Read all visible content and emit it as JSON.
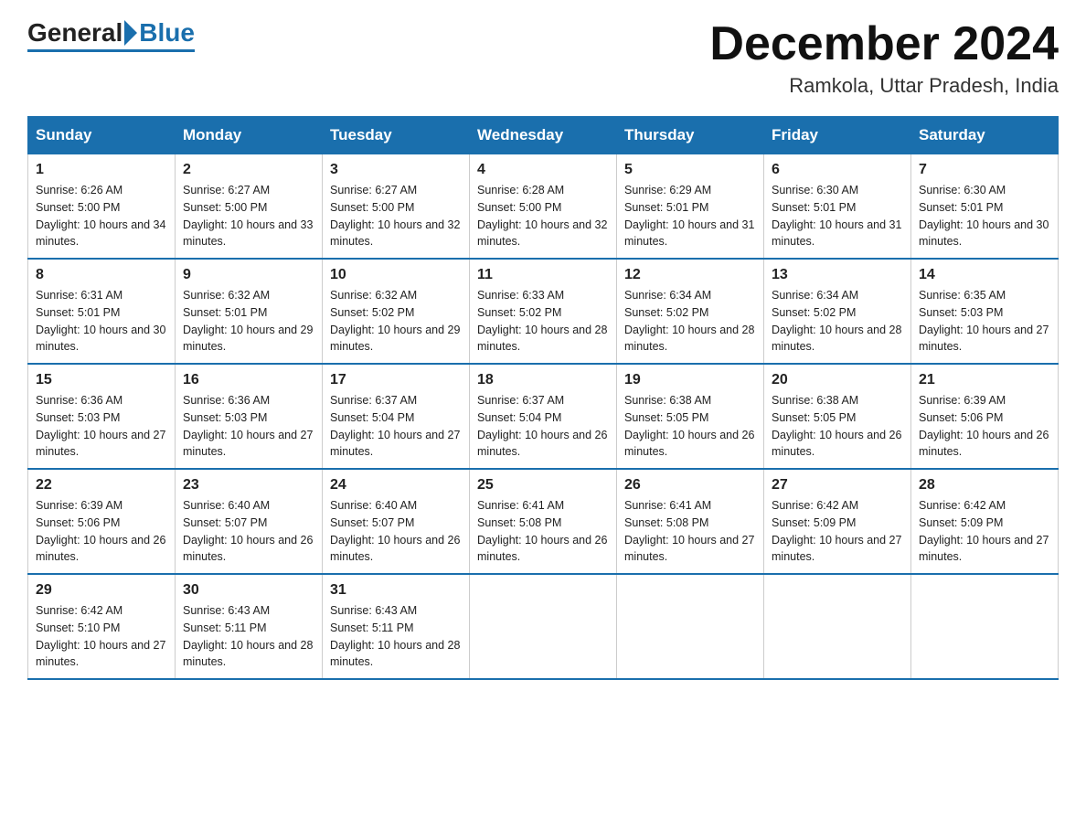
{
  "logo": {
    "general": "General",
    "blue": "Blue"
  },
  "header": {
    "month_title": "December 2024",
    "location": "Ramkola, Uttar Pradesh, India"
  },
  "weekdays": [
    "Sunday",
    "Monday",
    "Tuesday",
    "Wednesday",
    "Thursday",
    "Friday",
    "Saturday"
  ],
  "weeks": [
    [
      {
        "day": "1",
        "sunrise": "6:26 AM",
        "sunset": "5:00 PM",
        "daylight": "10 hours and 34 minutes."
      },
      {
        "day": "2",
        "sunrise": "6:27 AM",
        "sunset": "5:00 PM",
        "daylight": "10 hours and 33 minutes."
      },
      {
        "day": "3",
        "sunrise": "6:27 AM",
        "sunset": "5:00 PM",
        "daylight": "10 hours and 32 minutes."
      },
      {
        "day": "4",
        "sunrise": "6:28 AM",
        "sunset": "5:00 PM",
        "daylight": "10 hours and 32 minutes."
      },
      {
        "day": "5",
        "sunrise": "6:29 AM",
        "sunset": "5:01 PM",
        "daylight": "10 hours and 31 minutes."
      },
      {
        "day": "6",
        "sunrise": "6:30 AM",
        "sunset": "5:01 PM",
        "daylight": "10 hours and 31 minutes."
      },
      {
        "day": "7",
        "sunrise": "6:30 AM",
        "sunset": "5:01 PM",
        "daylight": "10 hours and 30 minutes."
      }
    ],
    [
      {
        "day": "8",
        "sunrise": "6:31 AM",
        "sunset": "5:01 PM",
        "daylight": "10 hours and 30 minutes."
      },
      {
        "day": "9",
        "sunrise": "6:32 AM",
        "sunset": "5:01 PM",
        "daylight": "10 hours and 29 minutes."
      },
      {
        "day": "10",
        "sunrise": "6:32 AM",
        "sunset": "5:02 PM",
        "daylight": "10 hours and 29 minutes."
      },
      {
        "day": "11",
        "sunrise": "6:33 AM",
        "sunset": "5:02 PM",
        "daylight": "10 hours and 28 minutes."
      },
      {
        "day": "12",
        "sunrise": "6:34 AM",
        "sunset": "5:02 PM",
        "daylight": "10 hours and 28 minutes."
      },
      {
        "day": "13",
        "sunrise": "6:34 AM",
        "sunset": "5:02 PM",
        "daylight": "10 hours and 28 minutes."
      },
      {
        "day": "14",
        "sunrise": "6:35 AM",
        "sunset": "5:03 PM",
        "daylight": "10 hours and 27 minutes."
      }
    ],
    [
      {
        "day": "15",
        "sunrise": "6:36 AM",
        "sunset": "5:03 PM",
        "daylight": "10 hours and 27 minutes."
      },
      {
        "day": "16",
        "sunrise": "6:36 AM",
        "sunset": "5:03 PM",
        "daylight": "10 hours and 27 minutes."
      },
      {
        "day": "17",
        "sunrise": "6:37 AM",
        "sunset": "5:04 PM",
        "daylight": "10 hours and 27 minutes."
      },
      {
        "day": "18",
        "sunrise": "6:37 AM",
        "sunset": "5:04 PM",
        "daylight": "10 hours and 26 minutes."
      },
      {
        "day": "19",
        "sunrise": "6:38 AM",
        "sunset": "5:05 PM",
        "daylight": "10 hours and 26 minutes."
      },
      {
        "day": "20",
        "sunrise": "6:38 AM",
        "sunset": "5:05 PM",
        "daylight": "10 hours and 26 minutes."
      },
      {
        "day": "21",
        "sunrise": "6:39 AM",
        "sunset": "5:06 PM",
        "daylight": "10 hours and 26 minutes."
      }
    ],
    [
      {
        "day": "22",
        "sunrise": "6:39 AM",
        "sunset": "5:06 PM",
        "daylight": "10 hours and 26 minutes."
      },
      {
        "day": "23",
        "sunrise": "6:40 AM",
        "sunset": "5:07 PM",
        "daylight": "10 hours and 26 minutes."
      },
      {
        "day": "24",
        "sunrise": "6:40 AM",
        "sunset": "5:07 PM",
        "daylight": "10 hours and 26 minutes."
      },
      {
        "day": "25",
        "sunrise": "6:41 AM",
        "sunset": "5:08 PM",
        "daylight": "10 hours and 26 minutes."
      },
      {
        "day": "26",
        "sunrise": "6:41 AM",
        "sunset": "5:08 PM",
        "daylight": "10 hours and 27 minutes."
      },
      {
        "day": "27",
        "sunrise": "6:42 AM",
        "sunset": "5:09 PM",
        "daylight": "10 hours and 27 minutes."
      },
      {
        "day": "28",
        "sunrise": "6:42 AM",
        "sunset": "5:09 PM",
        "daylight": "10 hours and 27 minutes."
      }
    ],
    [
      {
        "day": "29",
        "sunrise": "6:42 AM",
        "sunset": "5:10 PM",
        "daylight": "10 hours and 27 minutes."
      },
      {
        "day": "30",
        "sunrise": "6:43 AM",
        "sunset": "5:11 PM",
        "daylight": "10 hours and 28 minutes."
      },
      {
        "day": "31",
        "sunrise": "6:43 AM",
        "sunset": "5:11 PM",
        "daylight": "10 hours and 28 minutes."
      },
      null,
      null,
      null,
      null
    ]
  ]
}
